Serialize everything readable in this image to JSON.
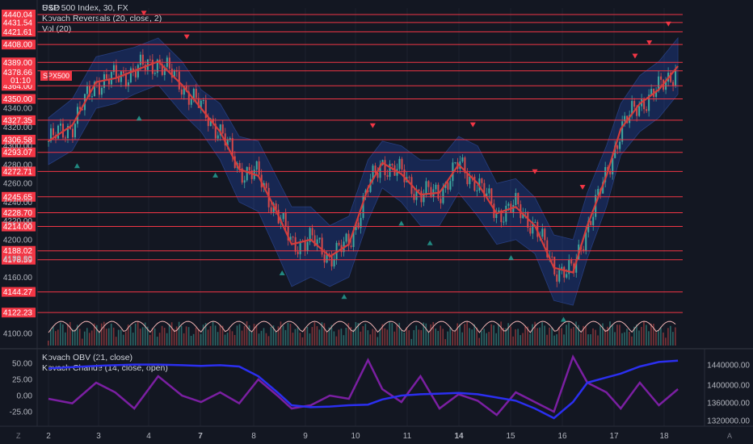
{
  "header": {
    "currency": "USD",
    "symbol_line": "S&P 500 Index, 30, FX",
    "indicator1": "Kovach Reversals (20, close, 2)",
    "indicator2": "Vol (20)",
    "lower_indicator1": "Kovach OBV (21, close)",
    "lower_indicator2": "Kovach Chande (14, close, open)",
    "symbol_badge": "SPX500",
    "corner_left": "Z",
    "corner_right": "A"
  },
  "colors": {
    "background": "#131722",
    "hline": "#f23645",
    "price_line": "#d33c3c",
    "band_fill": "#2962ff",
    "obv": "#2b2ff0",
    "chande": "#7b1fa2",
    "vol_line": "#f0b4b4",
    "candle_up": "#3fa9a0",
    "candle_down": "#d64a4a"
  },
  "chart_data": {
    "type": "line",
    "title": "S&P 500 Index, 30, FX",
    "x_ticks": [
      "2",
      "3",
      "4",
      "7",
      "8",
      "9",
      "10",
      "11",
      "14",
      "15",
      "16",
      "17",
      "18"
    ],
    "y_ticks": [
      "4340.00",
      "4320.00",
      "4300.00",
      "4280.00",
      "4260.00",
      "4240.00",
      "4220.00",
      "4200.00",
      "4180.00",
      "4160.00",
      "4100.00"
    ],
    "ylim": [
      4100,
      4450
    ],
    "last_price": {
      "value": "4378.66",
      "countdown": "01:10"
    },
    "horizontal_levels": [
      "4440.04",
      "4431.54",
      "4421.61",
      "4408.00",
      "4389.00",
      "4380.00",
      "4364.00",
      "4350.00",
      "4327.35",
      "4306.58",
      "4293.07",
      "4272.71",
      "4245.65",
      "4228.70",
      "4214.00",
      "4188.02",
      "4178.59",
      "4144.27",
      "4122.23"
    ],
    "price_series": {
      "name": "",
      "x": [
        0,
        0.5,
        1,
        1.4,
        1.8,
        2.3,
        2.8,
        3.2,
        3.6,
        4,
        4.4,
        4.8,
        5.1,
        5.5,
        5.9,
        6.3,
        6.7,
        7,
        7.4,
        7.8,
        8.2,
        8.6,
        9,
        9.4,
        9.8,
        10.2,
        10.6,
        11,
        11.3,
        11.7,
        12,
        12.4,
        12.8,
        13.2
      ],
      "values": [
        4305,
        4322,
        4368,
        4372,
        4380,
        4390,
        4365,
        4340,
        4315,
        4275,
        4268,
        4228,
        4195,
        4200,
        4182,
        4195,
        4255,
        4282,
        4270,
        4248,
        4250,
        4280,
        4260,
        4228,
        4235,
        4215,
        4170,
        4165,
        4215,
        4268,
        4318,
        4345,
        4360,
        4385
      ]
    },
    "band_upper": [
      4330,
      4350,
      4395,
      4400,
      4405,
      4415,
      4390,
      4360,
      4345,
      4310,
      4305,
      4265,
      4235,
      4235,
      4215,
      4225,
      4285,
      4305,
      4300,
      4285,
      4285,
      4310,
      4300,
      4260,
      4265,
      4245,
      4205,
      4200,
      4250,
      4300,
      4345,
      4375,
      4390,
      4415
    ],
    "band_lower": [
      4280,
      4295,
      4340,
      4345,
      4355,
      4365,
      4335,
      4315,
      4285,
      4240,
      4230,
      4185,
      4150,
      4160,
      4150,
      4160,
      4220,
      4255,
      4240,
      4215,
      4215,
      4250,
      4225,
      4195,
      4200,
      4185,
      4135,
      4130,
      4180,
      4235,
      4290,
      4315,
      4330,
      4355
    ],
    "reversal_down_x": [
      2.0,
      2.9,
      6.8,
      8.9,
      10.2,
      12.3,
      11.2,
      12.6,
      13.0
    ],
    "reversal_up_x": [
      0.6,
      1.9,
      3.5,
      4.9,
      6.2,
      7.4,
      8.0,
      9.7,
      10.8
    ],
    "lower_pane": {
      "y_ticks_left": [
        "50.00",
        "25.00",
        "0.00",
        "-25.00"
      ],
      "y_ticks_right": [
        "1440000.00",
        "1400000.00",
        "1360000.00",
        "1320000.00"
      ],
      "obv_values": [
        42,
        44,
        46,
        47,
        48,
        48,
        47,
        46,
        47,
        45,
        30,
        5,
        -15,
        -18,
        -17,
        -15,
        -14,
        -6,
        0,
        2,
        3,
        4,
        2,
        -3,
        -8,
        -20,
        -35,
        -10,
        20,
        28,
        34,
        45,
        52,
        54
      ],
      "chande_values": [
        -5,
        -12,
        20,
        5,
        -20,
        30,
        0,
        -10,
        5,
        -12,
        25,
        0,
        -20,
        -15,
        0,
        -5,
        55,
        10,
        -10,
        30,
        -20,
        2,
        -8,
        -30,
        5,
        -10,
        -25,
        60,
        20,
        5,
        -20,
        20,
        -15,
        10
      ]
    }
  }
}
